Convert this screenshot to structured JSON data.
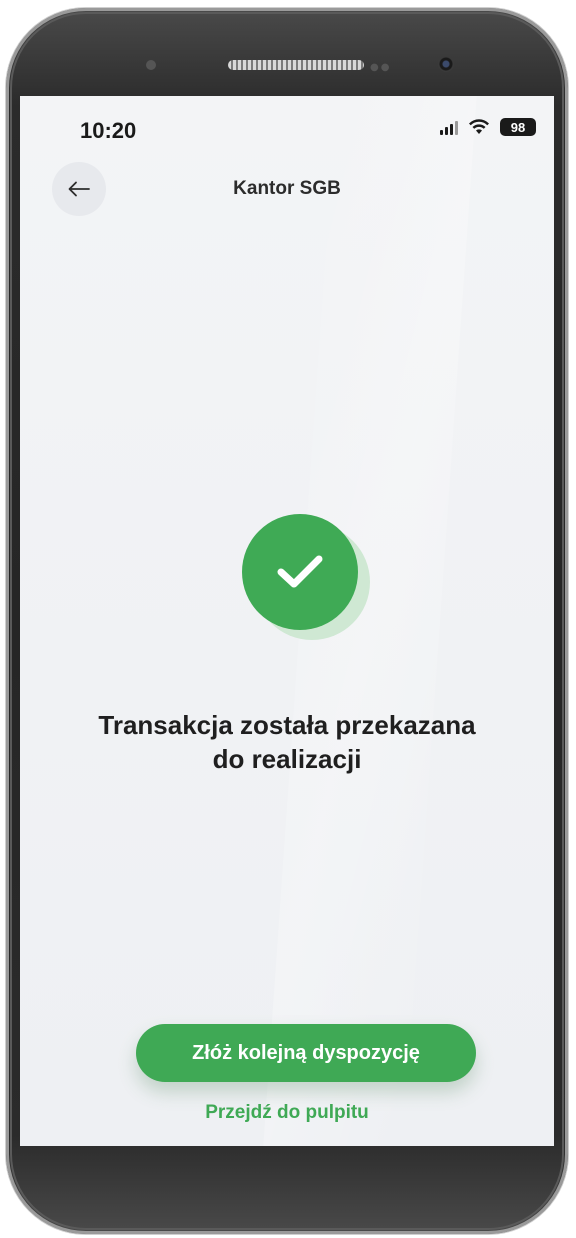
{
  "status_bar": {
    "time": "10:20",
    "battery": "98"
  },
  "header": {
    "title": "Kantor SGB",
    "back_icon": "arrow-left-icon"
  },
  "result": {
    "icon": "check-circle-icon",
    "message_line1": "Transakcja została przekazana",
    "message_line2": "do realizacji"
  },
  "actions": {
    "primary_label": "Złóż kolejną dyspozycję",
    "secondary_label": "Przejdź do pulpitu"
  },
  "colors": {
    "accent": "#3fa955",
    "screen_background": "#f1f2f4",
    "text": "#1f1f1f"
  }
}
